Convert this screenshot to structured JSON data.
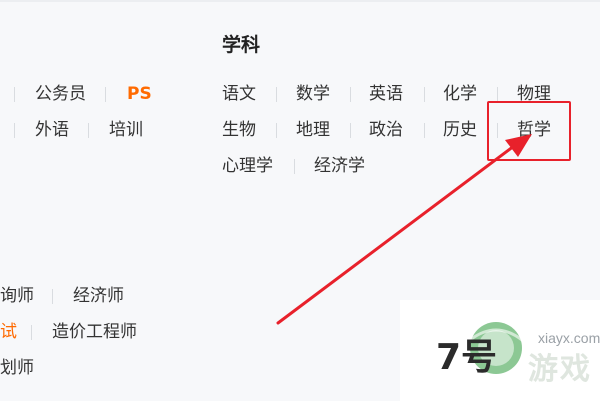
{
  "subjects": {
    "title": "学科",
    "rows": [
      [
        "语文",
        "数学",
        "英语",
        "化学",
        "物理"
      ],
      [
        "生物",
        "地理",
        "政治",
        "历史",
        "哲学"
      ],
      [
        "心理学",
        "经济学"
      ]
    ],
    "highlighted": "哲学"
  },
  "left_partial": {
    "row1": [
      "公务员",
      "PS"
    ],
    "row2": [
      "外语",
      "培训"
    ],
    "row3": [
      "询师",
      "经济师"
    ],
    "row4": [
      "试",
      "造价工程师"
    ],
    "row5": [
      "划师"
    ]
  },
  "watermark": {
    "seven": "7号",
    "domain": "xiayx.com",
    "cn": "游戏"
  },
  "colors": {
    "accent_orange": "#ff6a00",
    "highlight_red": "#e8212b"
  }
}
